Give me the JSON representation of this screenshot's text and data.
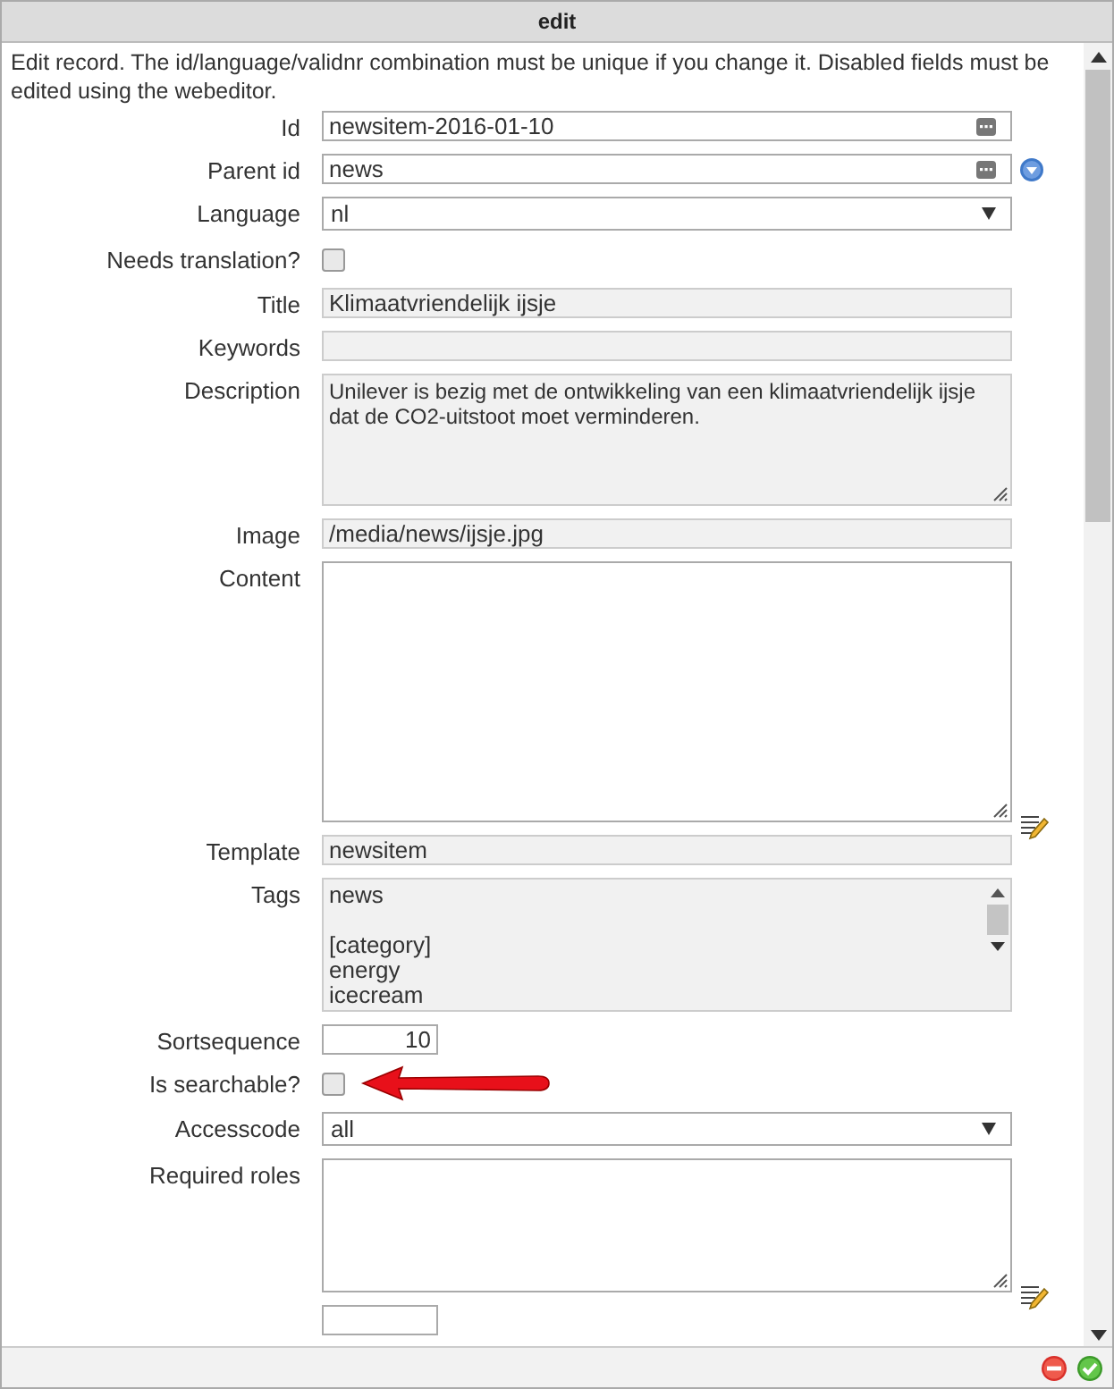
{
  "dialog": {
    "title": "edit",
    "intro": "Edit record. The id/language/validnr combination must be unique if you change it. Disabled fields must be edited using the webeditor."
  },
  "fields": [
    {
      "kind": "text",
      "label": "Id",
      "value": "newsitem-2016-01-10",
      "disabled": false,
      "picker": true
    },
    {
      "kind": "text",
      "label": "Parent id",
      "value": "news",
      "disabled": false,
      "picker": true,
      "lookup": true
    },
    {
      "kind": "select",
      "label": "Language",
      "value": "nl"
    },
    {
      "kind": "checkbox",
      "label": "Needs translation?",
      "checked": false,
      "highlighted": false
    },
    {
      "kind": "text",
      "label": "Title",
      "value": "Klimaatvriendelijk ijsje",
      "disabled": true
    },
    {
      "kind": "text",
      "label": "Keywords",
      "disabled": true
    },
    {
      "kind": "textarea",
      "label": "Description",
      "value": "Unilever is bezig met de ontwikkeling van een klimaatvriendelijk ijsje dat de CO2-uitstoot moet verminderen.",
      "disabled": true
    },
    {
      "kind": "text",
      "label": "Image",
      "value": "/media/news/ijsje.jpg",
      "disabled": true
    },
    {
      "kind": "textarea",
      "label": "Content",
      "disabled": false,
      "editor": true
    },
    {
      "kind": "text",
      "label": "Template",
      "value": "newsitem",
      "disabled": true
    },
    {
      "kind": "list",
      "label": "Tags",
      "value": "news\n\n[category]\nenergy\nicecream",
      "disabled": true
    },
    {
      "kind": "number",
      "label": "Sortsequence",
      "value": "10"
    },
    {
      "kind": "checkbox",
      "label": "Is searchable?",
      "checked": false,
      "highlighted": true
    },
    {
      "kind": "select",
      "label": "Accesscode",
      "value": "all"
    },
    {
      "kind": "textarea",
      "label": "Required roles",
      "disabled": false,
      "editor": true
    },
    {
      "kind": "number"
    }
  ]
}
